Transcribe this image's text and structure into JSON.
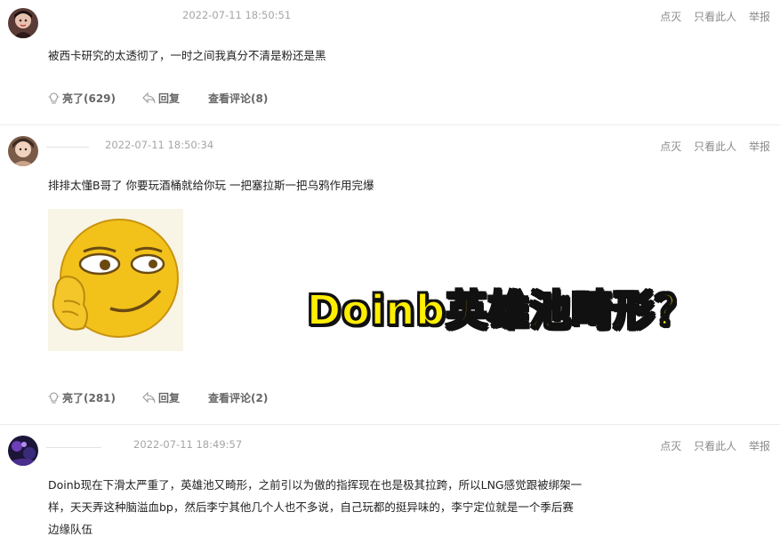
{
  "comments": [
    {
      "time": "2022-07-11 18:50:51",
      "ops": [
        "点灭",
        "只看此人",
        "举报"
      ],
      "text": "被西卡研究的太透彻了，一时之间我真分不清是粉还是黑",
      "like_label": "亮了(629)",
      "reply_label": "回复",
      "view_replies_label": "查看评论(8)"
    },
    {
      "time": "2022-07-11 18:50:34",
      "ops": [
        "点灭",
        "只看此人",
        "举报"
      ],
      "text": "排排太懂B哥了 你要玩酒桶就给你玩 一把塞拉斯一把乌鸦作用完爆",
      "like_label": "亮了(281)",
      "reply_label": "回复",
      "view_replies_label": "查看评论(2)"
    },
    {
      "time": "2022-07-11 18:49:57",
      "ops": [
        "点灭",
        "只看此人",
        "举报"
      ],
      "text_lines": [
        "Doinb现在下滑太严重了，英雄池又畸形，之前引以为傲的指挥现在也是极其拉跨，所以LNG感觉跟被绑架一",
        "样，天天弄这种脑溢血bp，然后李宁其他几个人也不多说，自己玩都的挺异味的，李宁定位就是一个季后赛",
        "边缘队伍"
      ]
    }
  ],
  "overlay_title": "Doinb英雄池畸形？",
  "colors": {
    "overlay_fill": "#ffee00",
    "overlay_stroke": "#111111",
    "emoji_yellow": "#f2c21b"
  },
  "icons": {
    "like": "lightbulb-icon",
    "reply": "reply-arrow-icon"
  }
}
